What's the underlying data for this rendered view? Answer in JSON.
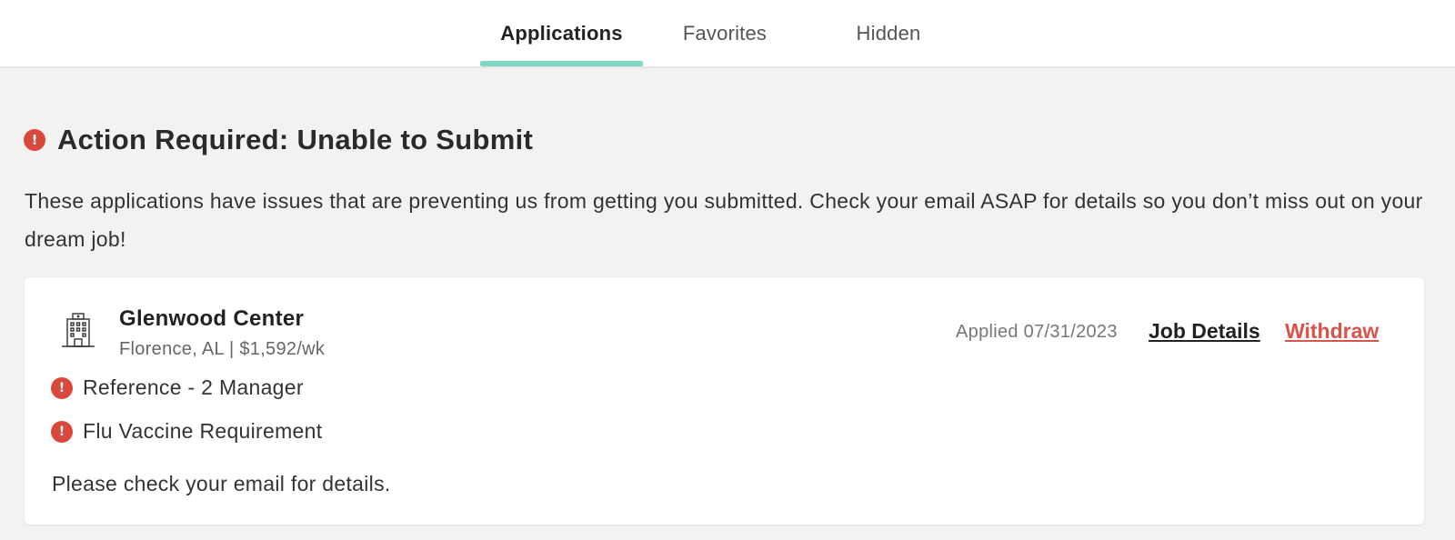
{
  "tabs": [
    {
      "label": "Applications",
      "active": true
    },
    {
      "label": "Favorites",
      "active": false
    },
    {
      "label": "Hidden",
      "active": false
    }
  ],
  "colors": {
    "accent": "#7dd8c4",
    "error": "#d9483b",
    "withdraw": "#d9534a"
  },
  "alert": {
    "icon": "error-icon",
    "title": "Action Required: Unable to Submit",
    "description": "These applications have issues that are preventing us from getting you submitted. Check your email ASAP for details so you don’t miss out on your dream job!"
  },
  "application": {
    "facility_icon": "building-icon",
    "facility_name": "Glenwood Center",
    "meta": "Florence, AL | $1,592/wk",
    "applied": "Applied 07/31/2023",
    "job_details_label": "Job Details",
    "withdraw_label": "Withdraw",
    "issues": [
      {
        "label": "Reference - 2 Manager"
      },
      {
        "label": "Flu Vaccine Requirement"
      }
    ],
    "footnote": "Please check your email for details."
  }
}
